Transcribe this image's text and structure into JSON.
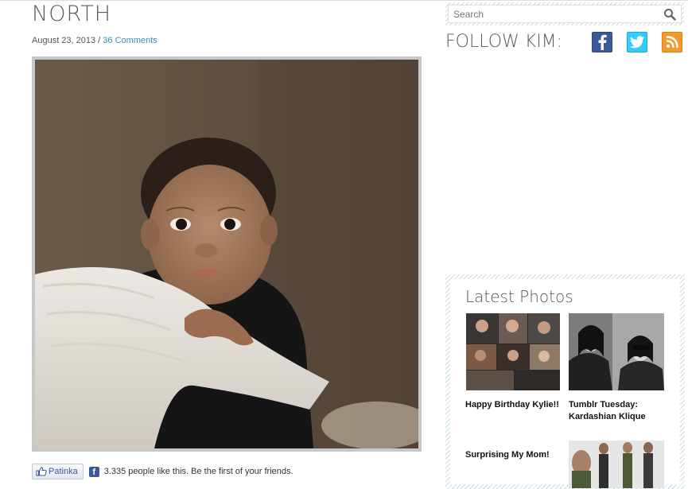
{
  "post": {
    "title": "NORTH",
    "date": "August 23, 2013",
    "separator": " / ",
    "comments_link": "36 Comments"
  },
  "like_bar": {
    "button_label": "Patinka",
    "fb_letter": "f",
    "text": "3.335 people like this. Be the first of your friends."
  },
  "sidebar": {
    "search": {
      "placeholder": "Search"
    },
    "follow": {
      "title": "FOLLOW KIM:",
      "icons": [
        "facebook-icon",
        "twitter-icon",
        "rss-icon"
      ],
      "colors": {
        "facebook": "#3b5998",
        "twitter": "#33ccff",
        "rss": "#f39a2c"
      }
    },
    "latest_photos": {
      "title": "Latest Photos",
      "items": [
        {
          "caption": "Happy Birthday Kylie!!"
        },
        {
          "caption": "Tumblr Tuesday: Kardashian Klique"
        },
        {
          "caption": "Surprising My Mom!"
        },
        {
          "caption": ""
        }
      ]
    }
  },
  "colors": {
    "link": "#3a8fb0",
    "title": "#5a5a5a",
    "stripe": "#c8dde2"
  }
}
